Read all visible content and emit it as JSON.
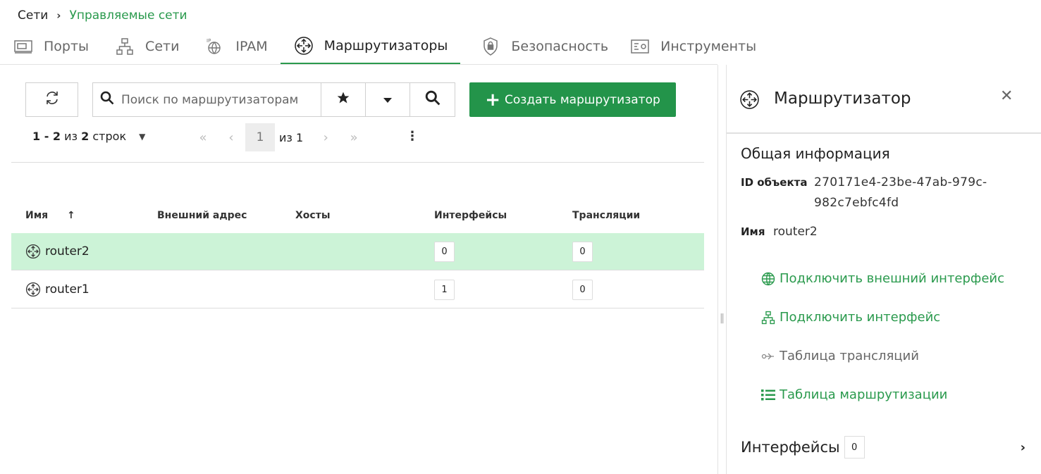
{
  "breadcrumb": {
    "root": "Сети",
    "current": "Управляемые сети"
  },
  "tabs": [
    {
      "label": "Порты",
      "icon": "port-icon"
    },
    {
      "label": "Сети",
      "icon": "network-icon"
    },
    {
      "label": "IPAM",
      "icon": "ipam-icon"
    },
    {
      "label": "Маршрутизаторы",
      "icon": "router-icon",
      "active": true
    },
    {
      "label": "Безопасность",
      "icon": "shield-icon"
    },
    {
      "label": "Инструменты",
      "icon": "tools-icon"
    }
  ],
  "toolbar": {
    "search_placeholder": "Поиск по маршрутизаторам",
    "create_label": "Создать маршрутизатор"
  },
  "pagination": {
    "range": "1 - 2",
    "of_word": "из",
    "total": "2",
    "rows_word": "строк",
    "page": "1",
    "page_of": "из 1"
  },
  "table": {
    "columns": [
      "Имя",
      "Внешний адрес",
      "Хосты",
      "Интерфейсы",
      "Трансляции"
    ],
    "sort_indicator": "↑",
    "rows": [
      {
        "name": "router2",
        "external": "",
        "hosts": "",
        "interfaces": "0",
        "translations": "0",
        "selected": true
      },
      {
        "name": "router1",
        "external": "",
        "hosts": "",
        "interfaces": "1",
        "translations": "0",
        "selected": false
      }
    ]
  },
  "panel": {
    "title": "Маршрутизатор",
    "section": "Общая информация",
    "id_label": "ID объекта",
    "id_value": "270171e4-23be-47ab-979c-982c7ebfc4fd",
    "name_label": "Имя",
    "name_value": "router2",
    "actions": [
      {
        "label": "Подключить внешний интерфейс",
        "icon": "globe-icon",
        "enabled": true
      },
      {
        "label": "Подключить интерфейс",
        "icon": "network-icon",
        "enabled": true
      },
      {
        "label": "Таблица трансляций",
        "icon": "nat-icon",
        "enabled": false
      },
      {
        "label": "Таблица маршрутизации",
        "icon": "list-icon",
        "enabled": true
      }
    ],
    "interfaces_title": "Интерфейсы",
    "interfaces_count": "0"
  },
  "colors": {
    "accent": "#2a9a4d",
    "button": "#23944a",
    "selected_row": "#ccf3d7"
  }
}
